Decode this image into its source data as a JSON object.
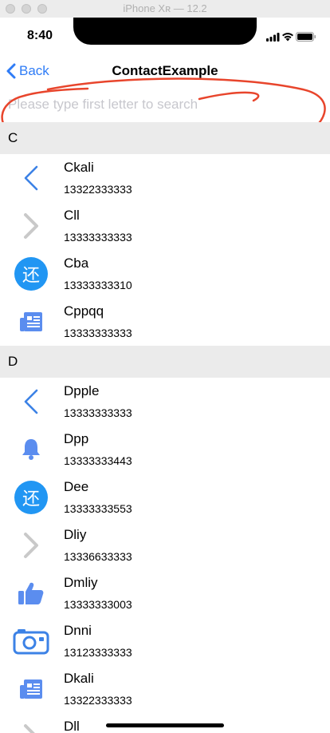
{
  "window": {
    "title": "iPhone Xʀ — 12.2"
  },
  "status_bar": {
    "time": "8:40"
  },
  "nav": {
    "back_label": "Back",
    "title": "ContactExample"
  },
  "search": {
    "placeholder": "Please type first letter to search",
    "value": ""
  },
  "colors": {
    "accent": "#2f7cf6",
    "icon_blue": "#2196f3",
    "annotation": "#e8452c"
  },
  "sections": [
    {
      "letter": "C",
      "items": [
        {
          "name": "Ckali",
          "phone": "13322333333",
          "icon": "chevron-left-icon"
        },
        {
          "name": "Cll",
          "phone": "13333333333",
          "icon": "chevron-right-icon"
        },
        {
          "name": "Cba",
          "phone": "13333333310",
          "icon": "return-badge-icon"
        },
        {
          "name": "Cppqq",
          "phone": "13333333333",
          "icon": "news-icon"
        }
      ]
    },
    {
      "letter": "D",
      "items": [
        {
          "name": "Dpple",
          "phone": "13333333333",
          "icon": "chevron-left-icon"
        },
        {
          "name": "Dpp",
          "phone": "13333333443",
          "icon": "bell-icon"
        },
        {
          "name": "Dee",
          "phone": "13333333553",
          "icon": "return-badge-icon"
        },
        {
          "name": "Dliy",
          "phone": "13336633333",
          "icon": "chevron-right-icon"
        },
        {
          "name": "Dmliy",
          "phone": "13333333003",
          "icon": "thumbs-up-icon"
        },
        {
          "name": "Dnni",
          "phone": "13123333333",
          "icon": "camera-icon"
        },
        {
          "name": "Dkali",
          "phone": "13322333333",
          "icon": "news-icon"
        },
        {
          "name": "Dll",
          "phone": "",
          "icon": "chevron-right-icon"
        }
      ]
    }
  ],
  "badge_char": "还"
}
